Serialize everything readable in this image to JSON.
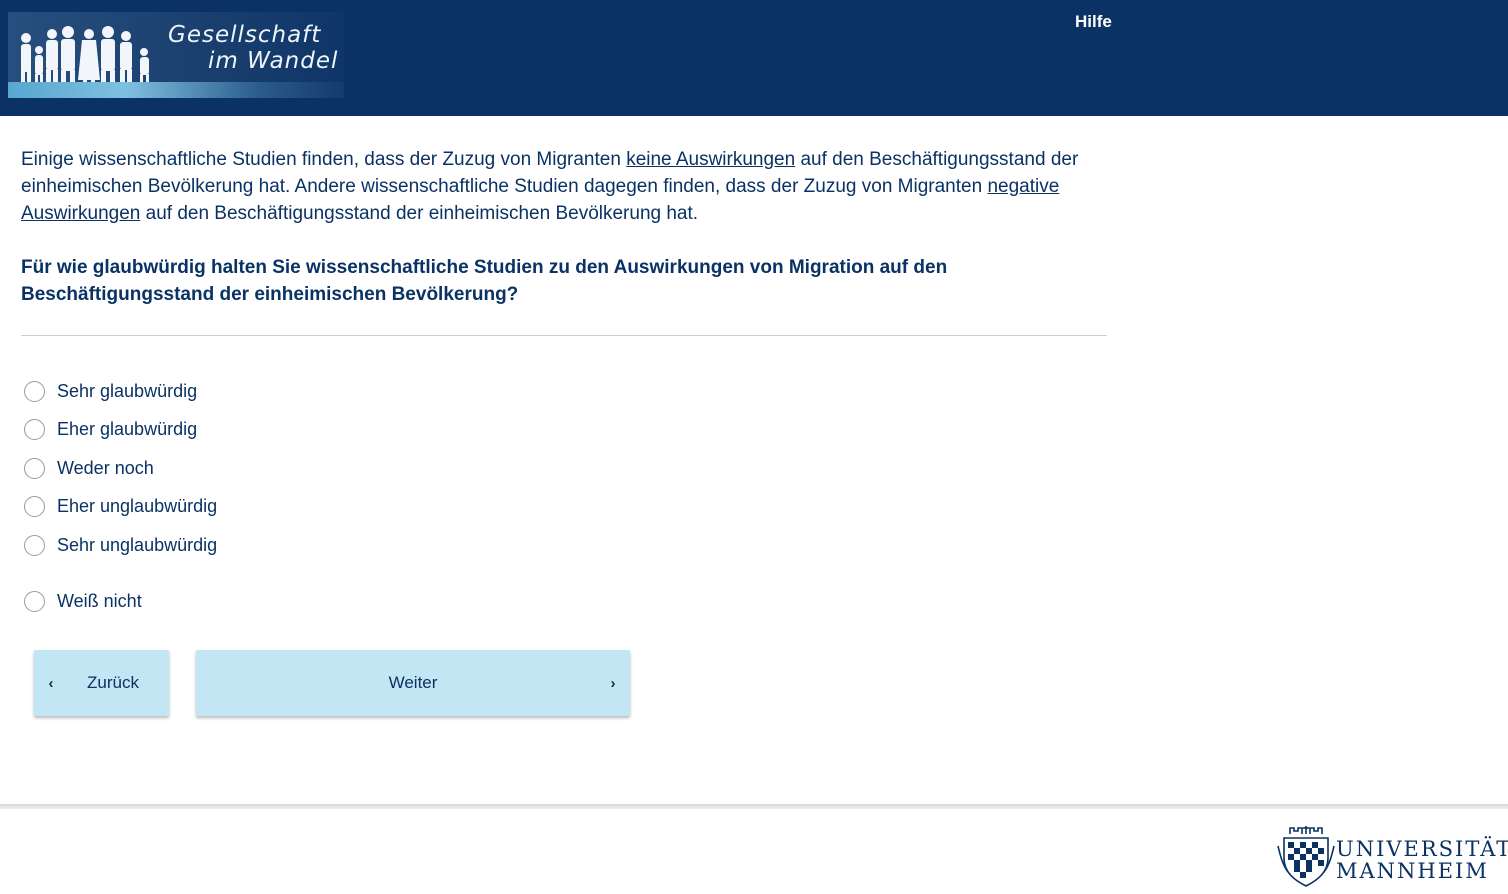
{
  "header": {
    "logo": {
      "line1": "Gesellschaft",
      "line2": "im Wandel"
    },
    "help_link": "Hilfe"
  },
  "intro": {
    "p1": "Einige wissenschaftliche Studien finden, dass der Zuzug von Migranten ",
    "link1": "keine Auswirkungen",
    "p2": " auf den Beschäftigungsstand der einheimischen Bevölkerung hat. Andere wissenschaftliche Studien dagegen finden, dass der Zuzug von Migranten ",
    "link2": "negative Auswirkungen",
    "p3": " auf den Beschäftigungsstand der einheimischen Bevölkerung hat."
  },
  "question": "Für wie glaubwürdig halten Sie wissenschaftliche Studien zu den Auswirkungen von Migration auf den Beschäftigungsstand der einheimischen Bevölkerung?",
  "options": [
    {
      "label": "Sehr glaubwürdig"
    },
    {
      "label": "Eher glaubwürdig"
    },
    {
      "label": "Weder noch"
    },
    {
      "label": "Eher unglaubwürdig"
    },
    {
      "label": "Sehr unglaubwürdig"
    },
    {
      "label": "Weiß nicht"
    }
  ],
  "nav": {
    "back_label": "Zurück",
    "next_label": "Weiter",
    "back_icon": "chevron-left-icon",
    "next_icon": "chevron-right-icon"
  },
  "footer": {
    "university_line1": "UNIVERSITÄT",
    "university_line2": "MANNHEIM"
  },
  "colors": {
    "header_bg": "#0a3264",
    "text": "#0a3264",
    "button_bg": "#c3e6f4"
  }
}
